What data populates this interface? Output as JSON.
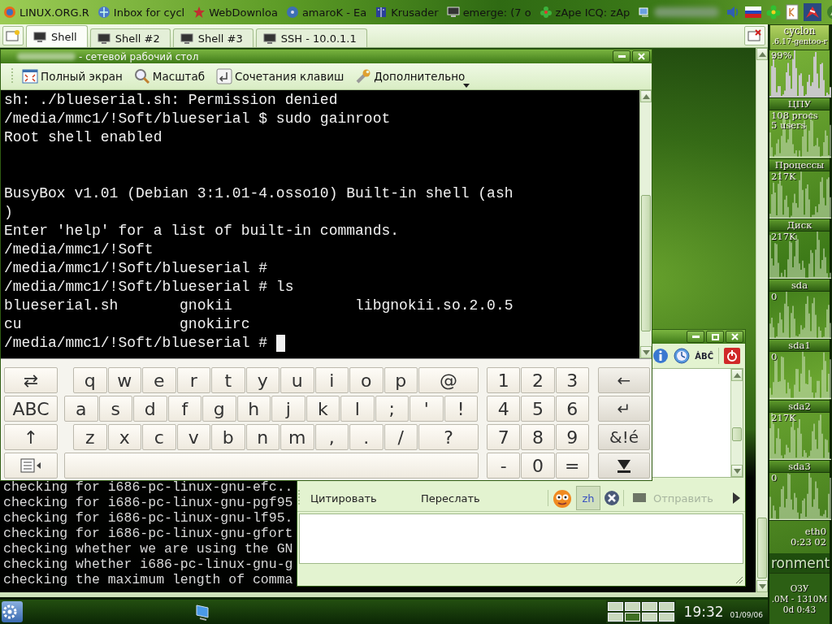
{
  "taskbar": {
    "tasks": [
      {
        "label": "LINUX.ORG.R"
      },
      {
        "label": "Inbox for cycl"
      },
      {
        "label": "WebDownloa"
      },
      {
        "label": "amaroK - Ea"
      },
      {
        "label": "Krusader"
      },
      {
        "label": "emerge: (7 o"
      },
      {
        "label": "zApe ICQ: zAp"
      }
    ]
  },
  "konsole": {
    "tabs": [
      {
        "label": "Shell",
        "selected": true
      },
      {
        "label": "Shell #2",
        "selected": false
      },
      {
        "label": "Shell #3",
        "selected": false
      },
      {
        "label": "SSH - 10.0.1.1",
        "selected": false
      }
    ],
    "lines": [
      "checking for i686-pc-linux-gnu-efc..",
      "checking for i686-pc-linux-gnu-pgf95",
      "checking for i686-pc-linux-gnu-lf95.",
      "checking for i686-pc-linux-gnu-gfort",
      "checking whether we are using the GN",
      "checking whether i686-pc-linux-gnu-g",
      "checking the maximum length of comma"
    ]
  },
  "remote_desktop": {
    "title": "- сетевой рабочий стол",
    "toolbar": [
      {
        "label": "Полный экран",
        "menu": false
      },
      {
        "label": "Масштаб",
        "menu": false
      },
      {
        "label": "Сочетания клавиш",
        "menu": false
      },
      {
        "label": "Дополнительно",
        "menu": true
      }
    ],
    "terminal": [
      {
        "kind": "text",
        "text": "sh: ./blueserial.sh: Permission denied"
      },
      {
        "kind": "text",
        "text": "/media/mmc1/!Soft/blueserial $ sudo gainroot"
      },
      {
        "kind": "text",
        "text": "Root shell enabled"
      },
      {
        "kind": "blank"
      },
      {
        "kind": "blank"
      },
      {
        "kind": "text",
        "text": "BusyBox v1.01 (Debian 3:1.01-4.osso10) Built-in shell (ash"
      },
      {
        "kind": "text",
        "text": ")"
      },
      {
        "kind": "text",
        "text": "Enter 'help' for a list of built-in commands."
      },
      {
        "kind": "text",
        "text": "/media/mmc1/!Soft"
      },
      {
        "kind": "text",
        "text": "/media/mmc1/!Soft/blueserial #"
      },
      {
        "kind": "text",
        "text": "/media/mmc1/!Soft/blueserial # ls"
      },
      {
        "kind": "columns",
        "cells": [
          "blueserial.sh",
          "gnokii",
          "libgnokii.so.2.0.5"
        ]
      },
      {
        "kind": "columns",
        "cells": [
          "cu",
          "gnokiirc"
        ]
      },
      {
        "kind": "prompt",
        "text": "/media/mmc1/!Soft/blueserial #",
        "cursor": true
      }
    ],
    "keyboard": {
      "mode_keys": [
        {
          "kind": "glyph",
          "label": "⇄"
        },
        {
          "kind": "glyph",
          "label": "ABC"
        },
        {
          "kind": "glyph",
          "label": "↑"
        },
        {
          "kind": "menu"
        }
      ],
      "letter_rows": [
        [
          "q",
          "w",
          "e",
          "r",
          "t",
          "y",
          "u",
          "i",
          "o",
          "p",
          "@"
        ],
        [
          "a",
          "s",
          "d",
          "f",
          "g",
          "h",
          "j",
          "k",
          "l",
          ";",
          "'",
          "!"
        ],
        [
          "z",
          "x",
          "c",
          "v",
          "b",
          "n",
          "m",
          ",",
          ".",
          "/",
          "?"
        ]
      ],
      "numpad": [
        [
          "1",
          "2",
          "3"
        ],
        [
          "4",
          "5",
          "6"
        ],
        [
          "7",
          "8",
          "9"
        ],
        [
          "-",
          "0",
          "="
        ]
      ],
      "side_keys": [
        {
          "kind": "glyph",
          "label": "←"
        },
        {
          "kind": "glyph",
          "label": "↵"
        },
        {
          "kind": "glyph",
          "label": "&!é"
        },
        {
          "kind": "hide"
        }
      ]
    }
  },
  "chat": {
    "spellcheck_label": "ȦBĈ",
    "actions": [
      {
        "label": "Цитировать"
      },
      {
        "label": "Переслать"
      }
    ],
    "language_button": {
      "label": "zh",
      "on": true
    },
    "send": {
      "label": "Отправить",
      "disabled": true
    }
  },
  "monitor": {
    "items": [
      {
        "kind": "header",
        "texts": [
          "cyclon",
          ".6.17-gentoo-r"
        ]
      },
      {
        "kind": "chart",
        "texts": [
          "99%"
        ]
      },
      {
        "kind": "label",
        "texts": [
          "ЦПУ"
        ]
      },
      {
        "kind": "chart",
        "texts": [
          "108 procs",
          "5 users"
        ]
      },
      {
        "kind": "label",
        "texts": [
          "Процессы"
        ]
      },
      {
        "kind": "chart",
        "texts": [
          "217K"
        ]
      },
      {
        "kind": "label",
        "texts": [
          "Диск"
        ]
      },
      {
        "kind": "chart",
        "texts": [
          "217K"
        ]
      },
      {
        "kind": "label",
        "texts": [
          "sda"
        ]
      },
      {
        "kind": "chart",
        "texts": [
          "0"
        ]
      },
      {
        "kind": "label",
        "texts": [
          "sda1"
        ]
      },
      {
        "kind": "chart",
        "texts": [
          "0"
        ]
      },
      {
        "kind": "label",
        "texts": [
          "sda2"
        ]
      },
      {
        "kind": "chart",
        "texts": [
          "217K"
        ]
      },
      {
        "kind": "label",
        "texts": [
          "sda3"
        ]
      },
      {
        "kind": "chart",
        "texts": [
          "0"
        ]
      },
      {
        "kind": "meter",
        "texts": [
          "eth0",
          "0:23 02"
        ]
      },
      {
        "kind": "banner",
        "texts": [
          "ronment"
        ]
      },
      {
        "kind": "meter",
        "texts": [
          "ОЗУ",
          ".0M - 1310M",
          "0d 0:43"
        ]
      }
    ]
  },
  "bottom_panel": {
    "pager": [
      {
        "selected": false
      },
      {
        "selected": false
      },
      {
        "selected": false
      },
      {
        "selected": false
      },
      {
        "selected": false
      },
      {
        "selected": true
      },
      {
        "selected": false
      },
      {
        "selected": false
      }
    ],
    "time": "19:32",
    "date": "01/09/06"
  }
}
